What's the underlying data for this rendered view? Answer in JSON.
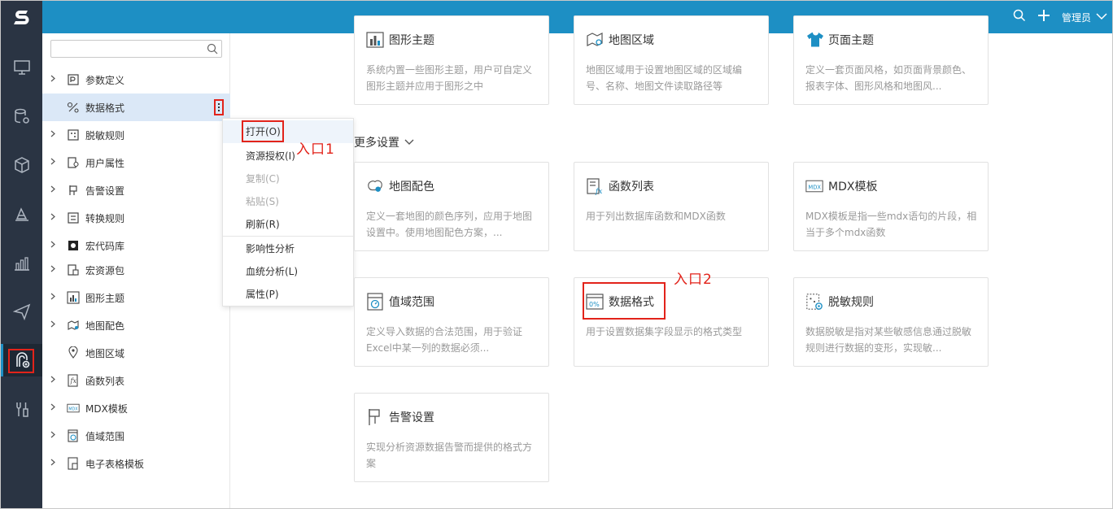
{
  "header": {
    "user_label": "管理员",
    "icons": [
      "search-icon",
      "plus-icon",
      "chevron-down-icon"
    ],
    "accent_color": "#1d8fc4",
    "nav_bg_color": "#2a3443"
  },
  "left_nav": {
    "items": [
      "monitor-icon",
      "database-settings-icon",
      "cube-icon",
      "design-icon",
      "chart-icon",
      "send-icon",
      "resource-lab-icon",
      "tools-icon"
    ],
    "active_index": 6
  },
  "tree": {
    "search_placeholder": "",
    "items": [
      {
        "label": "参数定义",
        "icon": "parameter-icon"
      },
      {
        "label": "数据格式",
        "icon": "data-format-icon",
        "selected": true
      },
      {
        "label": "脱敏规则",
        "icon": "masking-rule-icon"
      },
      {
        "label": "用户属性",
        "icon": "user-attribute-icon"
      },
      {
        "label": "告警设置",
        "icon": "alert-flag-icon"
      },
      {
        "label": "转换规则",
        "icon": "transform-rule-icon"
      },
      {
        "label": "宏代码库",
        "icon": "macro-library-icon"
      },
      {
        "label": "宏资源包",
        "icon": "macro-package-icon"
      },
      {
        "label": "图形主题",
        "icon": "chart-theme-icon"
      },
      {
        "label": "地图配色",
        "icon": "map-color-icon"
      },
      {
        "label": "地图区域",
        "icon": "map-region-icon"
      },
      {
        "label": "函数列表",
        "icon": "function-list-icon"
      },
      {
        "label": "MDX模板",
        "icon": "mdx-template-icon"
      },
      {
        "label": "值域范围",
        "icon": "value-range-icon"
      },
      {
        "label": "电子表格模板",
        "icon": "spreadsheet-template-icon"
      }
    ]
  },
  "context_menu": {
    "items": [
      {
        "label": "打开(O)",
        "disabled": false
      },
      {
        "label": "资源授权(I)",
        "disabled": false
      },
      {
        "label": "复制(C)",
        "disabled": true
      },
      {
        "label": "粘贴(S)",
        "disabled": true
      },
      {
        "label": "刷新(R)",
        "disabled": false
      },
      {
        "label": "影响性分析",
        "disabled": false
      },
      {
        "label": "血统分析(L)",
        "disabled": false
      },
      {
        "label": "属性(P)",
        "disabled": false
      }
    ]
  },
  "annotations": {
    "entry1": "入口1",
    "entry2": "入口2",
    "color": "#e2231a"
  },
  "main": {
    "more_settings": "更多设置",
    "top_cards": [
      {
        "title": "图形主题",
        "desc": "系统内置一些图形主题，用户可自定义图形主题并应用于图形之中",
        "icon": "chart-theme-icon"
      },
      {
        "title": "地图区域",
        "desc": "地图区域用于设置地图区域的区域编号、名称、地图文件读取路径等",
        "icon": "map-region-icon"
      },
      {
        "title": "页面主题",
        "desc": "定义一套页面风格，如页面背景颜色、报表字体、图形风格和地图风...",
        "icon": "page-theme-icon"
      }
    ],
    "cards": [
      {
        "title": "地图配色",
        "desc": "定义一套地图的颜色序列，应用于地图设置中。使用地图配色方案，...",
        "icon": "map-color-icon"
      },
      {
        "title": "函数列表",
        "desc": "用于列出数据库函数和MDX函数",
        "icon": "function-list-icon"
      },
      {
        "title": "MDX模板",
        "desc": "MDX模板是指一些mdx语句的片段，相当于多个mdx函数",
        "icon": "mdx-template-icon"
      },
      {
        "title": "值域范围",
        "desc": "定义导入数据的合法范围，用于验证Excel中某一列的数据必须...",
        "icon": "value-range-icon"
      },
      {
        "title": "数据格式",
        "desc": "用于设置数据集字段显示的格式类型",
        "icon": "data-format-icon"
      },
      {
        "title": "脱敏规则",
        "desc": "数据脱敏是指对某些敏感信息通过脱敏规则进行数据的变形，实现敏...",
        "icon": "masking-rule-icon"
      },
      {
        "title": "告警设置",
        "desc": "实现分析资源数据告警而提供的格式方案",
        "icon": "alert-flag-icon"
      }
    ]
  }
}
